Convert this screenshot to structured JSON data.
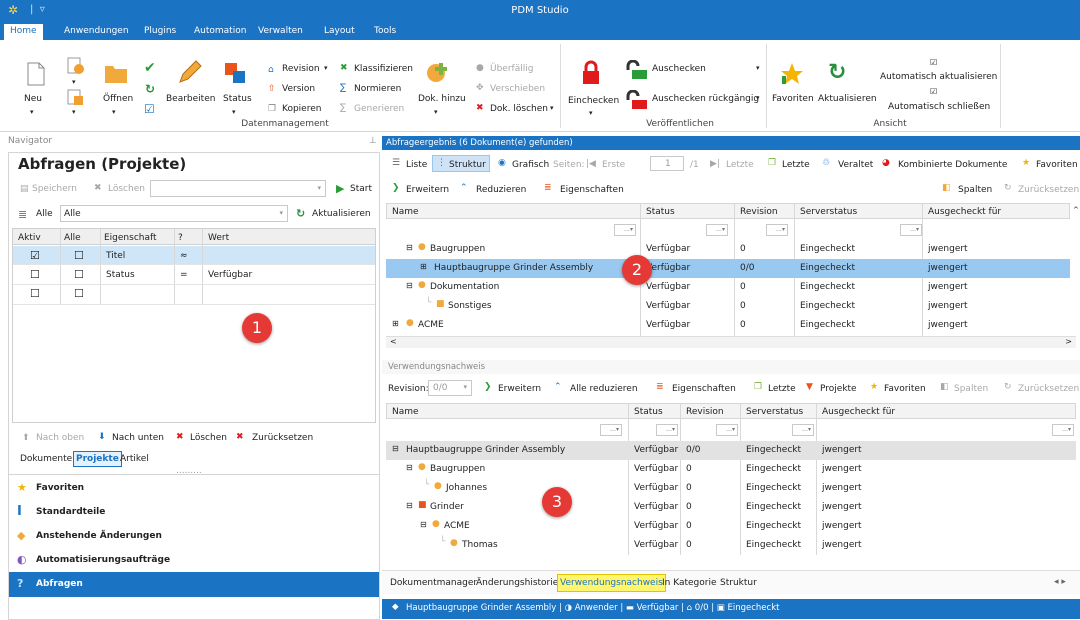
{
  "app": {
    "title": "PDM Studio"
  },
  "menu": {
    "tabs": [
      "Home",
      "Anwendungen",
      "Plugins",
      "Automation",
      "Verwalten",
      "Layout",
      "Tools"
    ]
  },
  "ribbon": {
    "neu": "Neu",
    "oeffnen": "Öffnen",
    "bearbeiten": "Bearbeiten",
    "status": "Status",
    "revision": "Revision",
    "version": "Version",
    "kopieren": "Kopieren",
    "klassifizieren": "Klassifizieren",
    "normieren": "Normieren",
    "generieren": "Generieren",
    "dok_hinzu": "Dok. hinzu",
    "ueberfaellig": "Überfällig",
    "verschieben": "Verschieben",
    "dok_loeschen": "Dok. löschen",
    "group_datenmanagement": "Datenmanagement",
    "einchecken": "Einchecken",
    "auschecken": "Auschecken",
    "auschecken_rueck": "Auschecken rückgängig",
    "group_veroeffentlichen": "Veröffentlichen",
    "favoriten": "Favoriten",
    "aktualisieren": "Aktualisieren",
    "auto_akt": "Automatisch aktualisieren",
    "auto_schl": "Automatisch schließen",
    "group_ansicht": "Ansicht"
  },
  "navigator": {
    "header": "Navigator",
    "title": "Abfragen (Projekte)",
    "speichern": "Speichern",
    "loeschen": "Löschen",
    "start": "Start",
    "alle_label": "Alle",
    "alle_value": "Alle",
    "aktualisieren": "Aktualisieren",
    "columns": [
      "Aktiv",
      "Alle",
      "Eigenschaft",
      "?",
      "Wert"
    ],
    "rows": [
      {
        "aktiv": "☑",
        "alle": "☐",
        "eigenschaft": "Titel",
        "op": "≈",
        "wert": ""
      },
      {
        "aktiv": "☐",
        "alle": "☐",
        "eigenschaft": "Status",
        "op": "=",
        "wert": "Verfügbar"
      },
      {
        "aktiv": "☐",
        "alle": "☐",
        "eigenschaft": "",
        "op": "",
        "wert": ""
      }
    ],
    "badge": "1",
    "nach_oben": "Nach oben",
    "nach_unten": "Nach unten",
    "loeschen2": "Löschen",
    "zuruecksetzen": "Zurücksetzen",
    "subtabs": [
      "Dokumente",
      "Projekte",
      "Artikel"
    ],
    "items": [
      "Favoriten",
      "Standardteile",
      "Anstehende Änderungen",
      "Automatisierungsaufträge",
      "Abfragen"
    ]
  },
  "result": {
    "title": "Abfrageergebnis (6 Dokument(e) gefunden)",
    "liste": "Liste",
    "struktur": "Struktur",
    "grafisch": "Grafisch",
    "seiten": "Seiten:",
    "erste": "Erste",
    "page": "1",
    "of": "/1",
    "letzte": "Letzte",
    "letzte2": "Letzte",
    "veraltet": "Veraltet",
    "kombiniert": "Kombinierte Dokumente",
    "favoriten": "Favoriten",
    "erweitern": "Erweitern",
    "reduzieren": "Reduzieren",
    "eigenschaften": "Eigenschaften",
    "spalten": "Spalten",
    "zuruecksetzen": "Zurücksetzen",
    "columns": [
      "Name",
      "Status",
      "Revision",
      "Serverstatus",
      "Ausgecheckt für"
    ],
    "rows": [
      {
        "name": "Baugruppen",
        "status": "Verfügbar",
        "rev": "0",
        "server": "Eingecheckt",
        "user": "jwengert"
      },
      {
        "name": "Hauptbaugruppe Grinder Assembly",
        "status": "Verfügbar",
        "rev": "0/0",
        "server": "Eingecheckt",
        "user": "jwengert"
      },
      {
        "name": "Dokumentation",
        "status": "Verfügbar",
        "rev": "0",
        "server": "Eingecheckt",
        "user": "jwengert"
      },
      {
        "name": "Sonstiges",
        "status": "Verfügbar",
        "rev": "0",
        "server": "Eingecheckt",
        "user": "jwengert"
      },
      {
        "name": "ACME",
        "status": "Verfügbar",
        "rev": "0",
        "server": "Eingecheckt",
        "user": "jwengert"
      }
    ],
    "badge": "2"
  },
  "usage": {
    "title": "Verwendungsnachweis",
    "revision_label": "Revision:",
    "revision_value": "0/0",
    "erweitern": "Erweitern",
    "alle_reduzieren": "Alle reduzieren",
    "eigenschaften": "Eigenschaften",
    "letzte": "Letzte",
    "projekte": "Projekte",
    "favoriten": "Favoriten",
    "spalten": "Spalten",
    "zuruecksetzen": "Zurücksetzen",
    "columns": [
      "Name",
      "Status",
      "Revision",
      "Serverstatus",
      "Ausgecheckt für"
    ],
    "rows": [
      {
        "name": "Hauptbaugruppe Grinder Assembly",
        "status": "Verfügbar",
        "rev": "0/0",
        "server": "Eingecheckt",
        "user": "jwengert"
      },
      {
        "name": "Baugruppen",
        "status": "Verfügbar",
        "rev": "0",
        "server": "Eingecheckt",
        "user": "jwengert"
      },
      {
        "name": "Johannes",
        "status": "Verfügbar",
        "rev": "0",
        "server": "Eingecheckt",
        "user": "jwengert"
      },
      {
        "name": "Grinder",
        "status": "Verfügbar",
        "rev": "0",
        "server": "Eingecheckt",
        "user": "jwengert"
      },
      {
        "name": "ACME",
        "status": "Verfügbar",
        "rev": "0",
        "server": "Eingecheckt",
        "user": "jwengert"
      },
      {
        "name": "Thomas",
        "status": "Verfügbar",
        "rev": "0",
        "server": "Eingecheckt",
        "user": "jwengert"
      }
    ],
    "badge": "3",
    "bottom_tabs": [
      "Dokumentmanager",
      "Änderungshistorie",
      "Verwendungsnachweis",
      "In Kategorie",
      "Struktur"
    ]
  },
  "statusbar": {
    "doc": "Hauptbaugruppe Grinder Assembly",
    "user": "Anwender",
    "status": "Verfügbar",
    "rev": "0/0",
    "server": "Eingecheckt"
  },
  "colors": {
    "accent": "#1b73c4",
    "selected": "#99c9f1",
    "badge": "#e53935"
  }
}
